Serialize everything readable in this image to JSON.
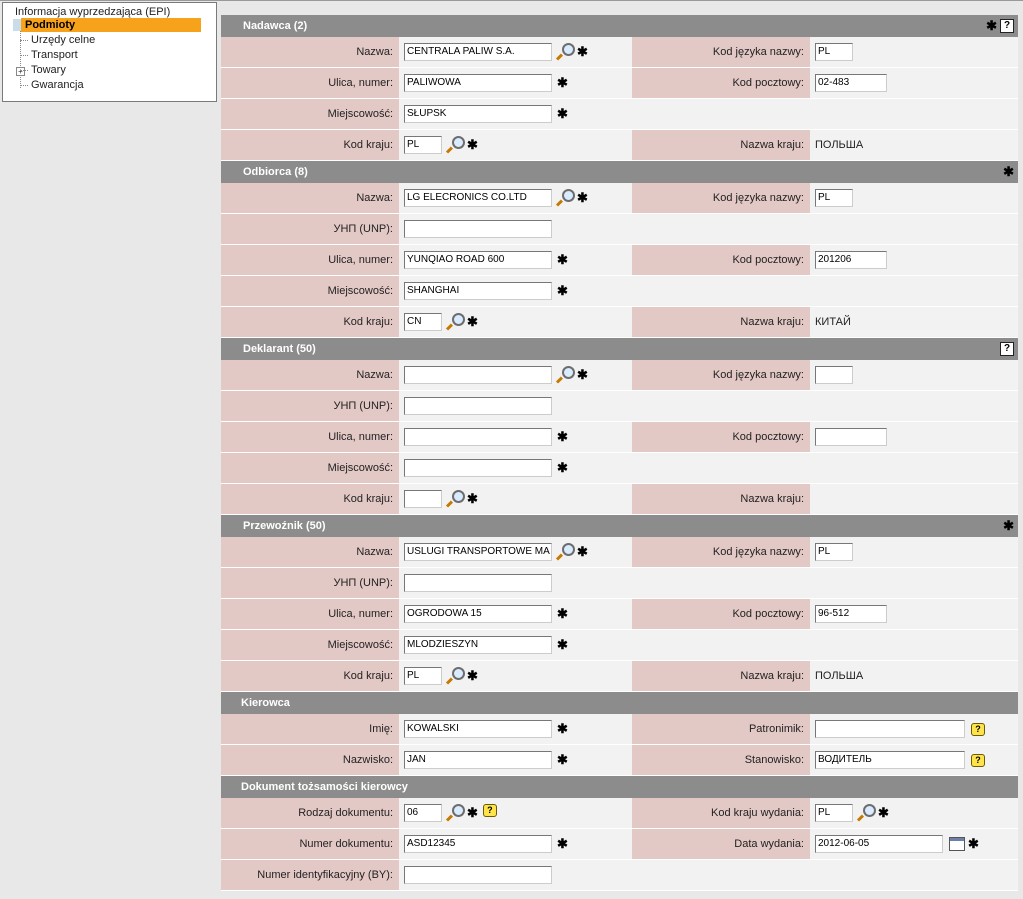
{
  "tree": {
    "root": "Informacja wyprzedzająca (EPI)",
    "items": [
      {
        "label": "Podmioty",
        "selected": true
      },
      {
        "label": "Urzędy celne"
      },
      {
        "label": "Transport"
      },
      {
        "label": "Towary",
        "expander": "+"
      },
      {
        "label": "Gwarancja"
      }
    ]
  },
  "sections": {
    "nadawca": {
      "title": "Nadawca (2)",
      "nazwa_label": "Nazwa:",
      "nazwa": "CENTRALA PALIW S.A.",
      "kod_jezyka_label": "Kod języka nazwy:",
      "kod_jezyka": "PL",
      "ulica_label": "Ulica, numer:",
      "ulica": "PALIWOWA",
      "kod_pocztowy_label": "Kod pocztowy:",
      "kod_pocztowy": "02-483",
      "miejscowosc_label": "Miejscowość:",
      "miejscowosc": "SŁUPSK",
      "kod_kraju_label": "Kod kraju:",
      "kod_kraju": "PL",
      "nazwa_kraju_label": "Nazwa kraju:",
      "nazwa_kraju": "ПОЛЬША"
    },
    "odbiorca": {
      "title": "Odbiorca (8)",
      "nazwa_label": "Nazwa:",
      "nazwa": "LG ELECRONICS CO.LTD",
      "kod_jezyka_label": "Kod języka nazwy:",
      "kod_jezyka": "PL",
      "unp_label": "УНП (UNP):",
      "unp": "",
      "ulica_label": "Ulica, numer:",
      "ulica": "YUNQIAO ROAD 600",
      "kod_pocztowy_label": "Kod pocztowy:",
      "kod_pocztowy": "201206",
      "miejscowosc_label": "Miejscowość:",
      "miejscowosc": "SHANGHAI",
      "kod_kraju_label": "Kod kraju:",
      "kod_kraju": "CN",
      "nazwa_kraju_label": "Nazwa kraju:",
      "nazwa_kraju": "КИТАЙ"
    },
    "deklarant": {
      "title": "Deklarant (50)",
      "nazwa_label": "Nazwa:",
      "nazwa": "",
      "kod_jezyka_label": "Kod języka nazwy:",
      "kod_jezyka": "",
      "unp_label": "УНП (UNP):",
      "unp": "",
      "ulica_label": "Ulica, numer:",
      "ulica": "",
      "kod_pocztowy_label": "Kod pocztowy:",
      "kod_pocztowy": "",
      "miejscowosc_label": "Miejscowość:",
      "miejscowosc": "",
      "kod_kraju_label": "Kod kraju:",
      "kod_kraju": "",
      "nazwa_kraju_label": "Nazwa kraju:",
      "nazwa_kraju": ""
    },
    "przewoznik": {
      "title": "Przewoźnik (50)",
      "nazwa_label": "Nazwa:",
      "nazwa": "USLUGI TRANSPORTOWE MA",
      "kod_jezyka_label": "Kod języka nazwy:",
      "kod_jezyka": "PL",
      "unp_label": "УНП (UNP):",
      "unp": "",
      "ulica_label": "Ulica, numer:",
      "ulica": "OGRODOWA 15",
      "kod_pocztowy_label": "Kod pocztowy:",
      "kod_pocztowy": "96-512",
      "miejscowosc_label": "Miejscowość:",
      "miejscowosc": "MLODZIESZYN",
      "kod_kraju_label": "Kod kraju:",
      "kod_kraju": "PL",
      "nazwa_kraju_label": "Nazwa kraju:",
      "nazwa_kraju": "ПОЛЬША"
    },
    "kierowca": {
      "title": "Kierowca",
      "imie_label": "Imię:",
      "imie": "KOWALSKI",
      "patronimik_label": "Patronimik:",
      "patronimik": "",
      "nazwisko_label": "Nazwisko:",
      "nazwisko": "JAN",
      "stanowisko_label": "Stanowisko:",
      "stanowisko": "ВОДИТЕЛЬ"
    },
    "dokument": {
      "title": "Dokument tożsamości kierowcy",
      "rodzaj_label": "Rodzaj dokumentu:",
      "rodzaj": "06",
      "kod_kraju_wydania_label": "Kod kraju wydania:",
      "kod_kraju_wydania": "PL",
      "numer_label": "Numer dokumentu:",
      "numer": "ASD12345",
      "data_wydania_label": "Data wydania:",
      "data_wydania": "2012-06-05",
      "nr_ident_label": "Numer identyfikacyjny (BY):",
      "nr_ident": ""
    }
  },
  "glyphs": {
    "required": "✱",
    "help": "?",
    "tip": "?"
  },
  "colors": {
    "highlight": "#f7a21b",
    "section_header": "#8c8c8c",
    "label_bg": "#e3c9c6",
    "value_bg": "#f2f2f2"
  }
}
